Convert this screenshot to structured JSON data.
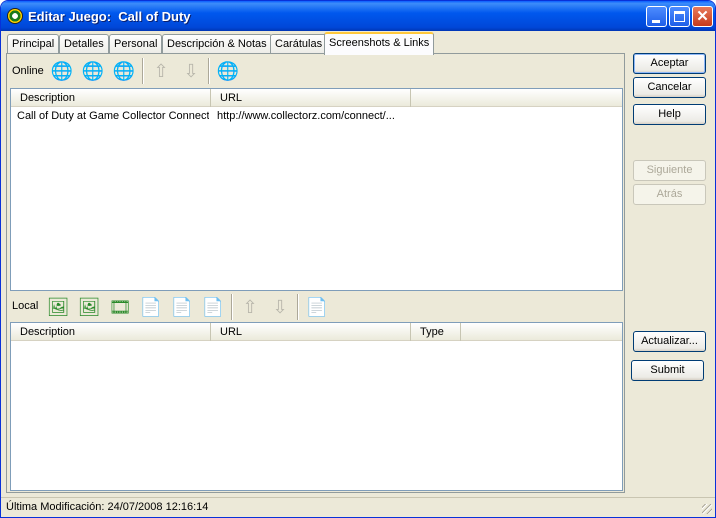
{
  "window": {
    "title": "Editar Juego:  Call of Duty"
  },
  "tabs": [
    "Principal",
    "Detalles",
    "Personal",
    "Descripción & Notas",
    "Carátulas",
    "Screenshots & Links"
  ],
  "online": {
    "label": "Online",
    "columns": [
      "Description",
      "URL"
    ],
    "rows": [
      {
        "description": "Call of Duty at Game Collector Connect",
        "url": "http://www.collectorz.com/connect/..."
      }
    ]
  },
  "local": {
    "label": "Local",
    "columns": [
      "Description",
      "URL",
      "Type"
    ],
    "rows": []
  },
  "buttons": {
    "aceptar": "Aceptar",
    "cancelar": "Cancelar",
    "help": "Help",
    "siguiente": "Siguiente",
    "atras": "Atrás",
    "actualizar": "Actualizar...",
    "submit": "Submit"
  },
  "status": {
    "text": "Última Modificación: 24/07/2008 12:16:14"
  },
  "icons": {
    "online_toolbar": [
      "add-link-icon",
      "edit-link-icon",
      "remove-link-icon",
      "move-up-icon",
      "move-down-icon",
      "open-link-icon"
    ],
    "local_toolbar": [
      "add-screenshot-icon",
      "add-image-icon",
      "add-video-icon",
      "add-file-icon",
      "edit-file-icon",
      "remove-file-icon",
      "move-up-icon",
      "move-down-icon",
      "open-file-icon"
    ]
  }
}
